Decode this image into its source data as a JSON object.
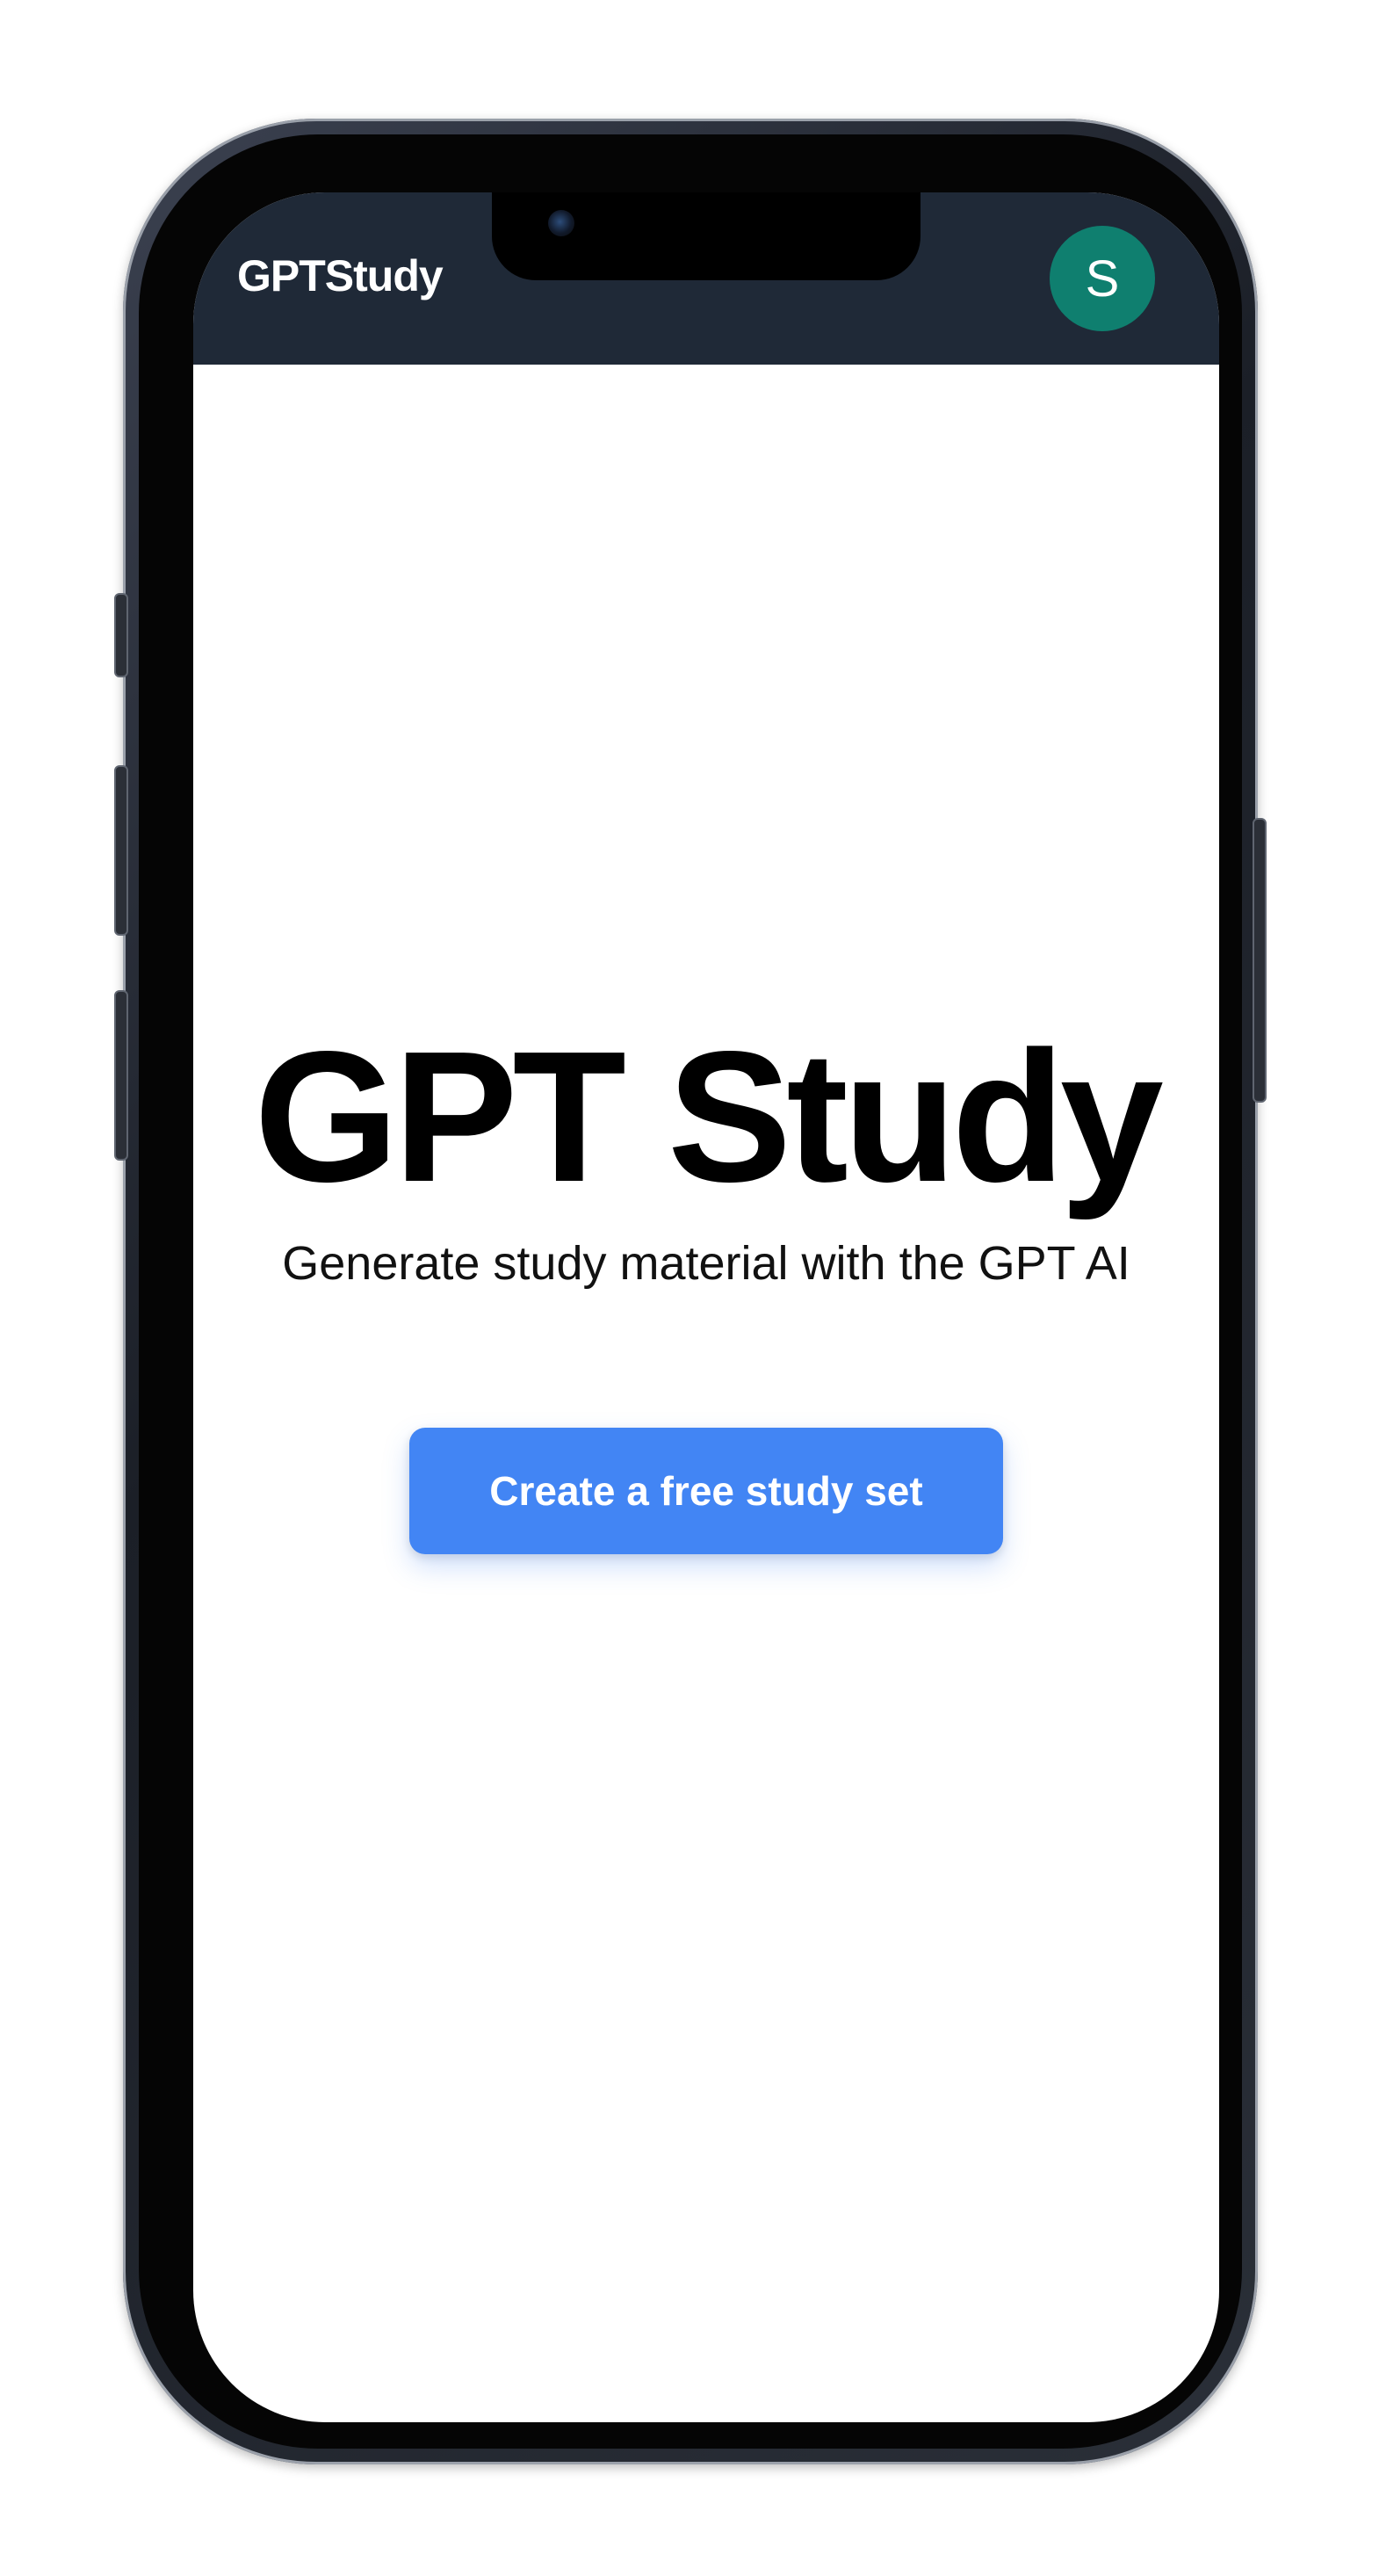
{
  "header": {
    "brand": "GPTStudy",
    "avatar_initial": "S",
    "avatar_color": "#0f7f6f",
    "background": "#1f2937"
  },
  "hero": {
    "title": "GPT Study",
    "subtitle": "Generate study material with the GPT AI"
  },
  "cta": {
    "label": "Create a free study set",
    "color": "#4285f4"
  }
}
